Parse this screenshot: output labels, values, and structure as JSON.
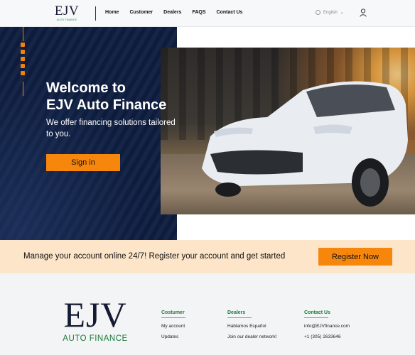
{
  "header": {
    "logo_mark": "EJV",
    "logo_sub": "AUTO FINANCE",
    "nav": [
      "Home",
      "Customer",
      "Dealers",
      "FAQS",
      "Contact Us"
    ],
    "language": "English"
  },
  "hero": {
    "title_line1": "Welcome to",
    "title_line2": "EJV Auto Finance",
    "subtitle": "We offer financing solutions tailored to you.",
    "signin_label": "Sign in"
  },
  "banner": {
    "text": "Manage your account online 24/7! Register your account and get started",
    "button_label": "Register Now"
  },
  "footer": {
    "logo_mark": "EJV",
    "logo_sub": "AUTO FINANCE",
    "columns": [
      {
        "heading": "Costumer",
        "items": [
          "My account",
          "Updates"
        ]
      },
      {
        "heading": "Dealers",
        "items": [
          "Hablamos Español",
          "Join our dealer network!"
        ]
      },
      {
        "heading": "Contact Us",
        "items": [
          "info@EJVfinance.com",
          "+1 (305) 2633646"
        ]
      }
    ]
  },
  "colors": {
    "accent": "#f7860d",
    "navy": "#0e1e40",
    "green": "#1d7a3a",
    "banner": "#fde5c9"
  }
}
